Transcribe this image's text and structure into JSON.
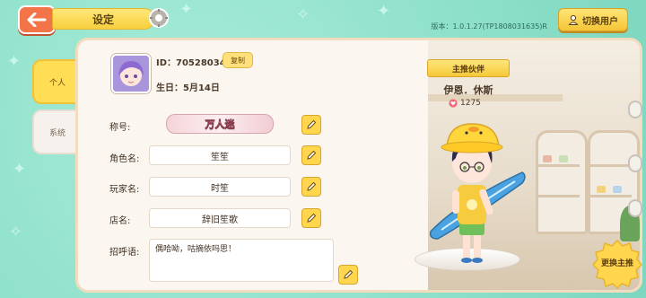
{
  "header": {
    "title": "设定",
    "version": "版本：1.0.1.27(TP1808031635)R",
    "switch_user": "切换用户"
  },
  "tabs": [
    {
      "label": "个人",
      "active": true
    },
    {
      "label": "系统",
      "active": false
    }
  ],
  "profile": {
    "id_text": "ID：70528034",
    "copy_label": "复制",
    "birthday": "生日：5月14日"
  },
  "fields": {
    "title_label": "称号:",
    "title_value": "万人迷",
    "role_label": "角色名:",
    "role_value": "笙笙",
    "player_label": "玩家名:",
    "player_value": "时笙",
    "shop_label": "店名:",
    "shop_value": "辞旧笙歌",
    "greeting_label": "招呼语:",
    "greeting_value": "偶哈呦，咕摘依吗思！"
  },
  "partner": {
    "ribbon": "主推伙伴",
    "name": "伊恩．休斯",
    "affinity": "1275",
    "change_label": "更换主推"
  },
  "colors": {
    "background": "#8ee4cf",
    "accent_yellow": "#ffd64e",
    "back_orange": "#f4744a"
  }
}
